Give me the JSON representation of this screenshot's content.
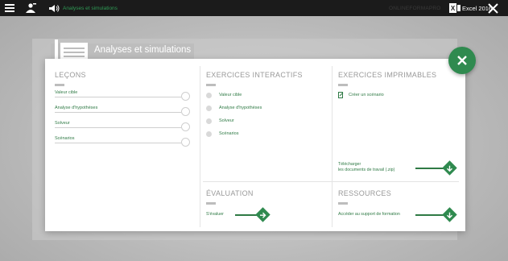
{
  "topbar": {
    "title": "Analyses et simulations",
    "brand": "ONLINEFORMAPRO",
    "product": "Excel 2016"
  },
  "module": {
    "title": "Analyses et simulations"
  },
  "lecons": {
    "title": "LEÇONS",
    "items": [
      "Valeur cible",
      "Analyse d'hypothèses",
      "Solveur",
      "Scénarios"
    ]
  },
  "exercices_interactifs": {
    "title": "EXERCICES INTERACTIFS",
    "items": [
      "Valeur cible",
      "Analyse d'hypothèses",
      "Solveur",
      "Scénarios"
    ]
  },
  "exercices_imprimables": {
    "title": "EXERCICES IMPRIMABLES",
    "item": "Créer un scénario",
    "download_line1": "Télécharger",
    "download_line2": "les documents de travail (.zip)"
  },
  "evaluation": {
    "title": "ÉVALUATION",
    "link": "S'évaluer"
  },
  "ressources": {
    "title": "RESSOURCES",
    "link": "Accéder au support de formation"
  },
  "colors": {
    "accent": "#2f8a4f",
    "topbar": "#1b1b1b"
  }
}
